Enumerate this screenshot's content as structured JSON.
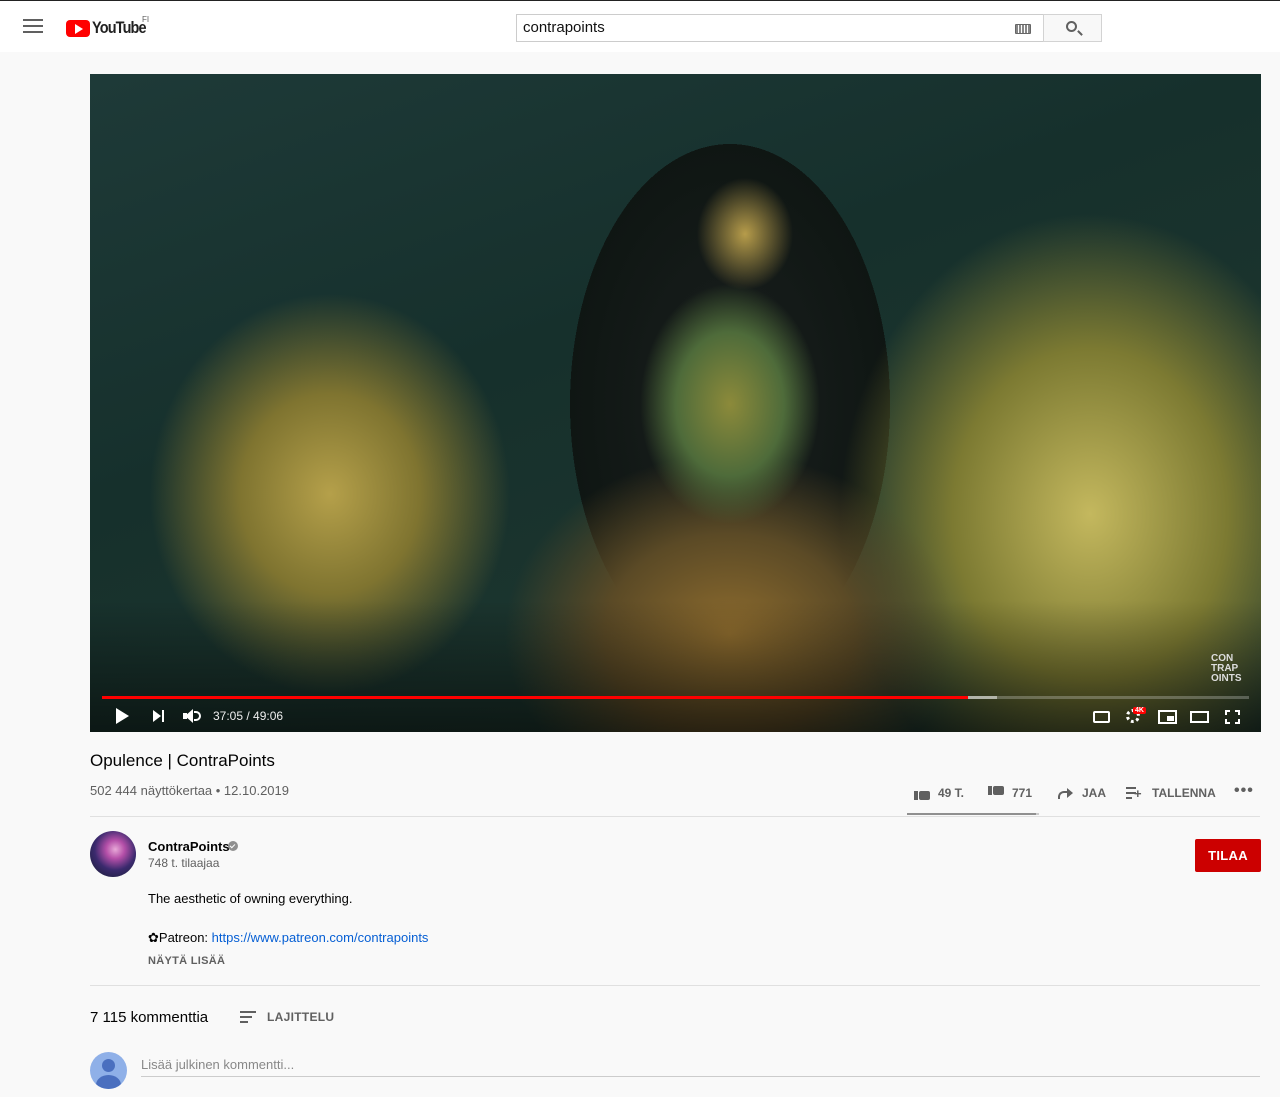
{
  "masthead": {
    "logo_text": "YouTube",
    "country_code": "FI",
    "search_value": "contrapoints"
  },
  "player": {
    "current_time": "37:05",
    "duration": "49:06",
    "time_display": "37:05 / 49:06",
    "played_fraction": 0.755,
    "loaded_fraction": 0.78,
    "watermark": "CON TRAP OINTS",
    "hd_badge": "4K"
  },
  "video": {
    "title": "Opulence | ContraPoints",
    "views_date": "502 444 näyttökertaa • 12.10.2019",
    "likes": "49 T.",
    "dislikes": "771",
    "like_ratio": 0.98,
    "share_label": "JAA",
    "save_label": "TALLENNA",
    "more_label": "•••"
  },
  "channel": {
    "name": "ContraPoints",
    "subscribers": "748 t. tilaajaa",
    "subscribe_label": "TILAA"
  },
  "description": {
    "line1": "The aesthetic of owning everything.",
    "patreon_prefix": "✿Patreon: ",
    "patreon_link": "https://www.patreon.com/contrapoints",
    "show_more": "NÄYTÄ LISÄÄ"
  },
  "comments": {
    "count": "7 115 kommenttia",
    "sort_label": "LAJITTELU",
    "input_placeholder": "Lisää julkinen kommentti..."
  },
  "colors": {
    "brand_red": "#ff0000",
    "subscribe_red": "#cc0000",
    "link_blue": "#065fd4"
  }
}
